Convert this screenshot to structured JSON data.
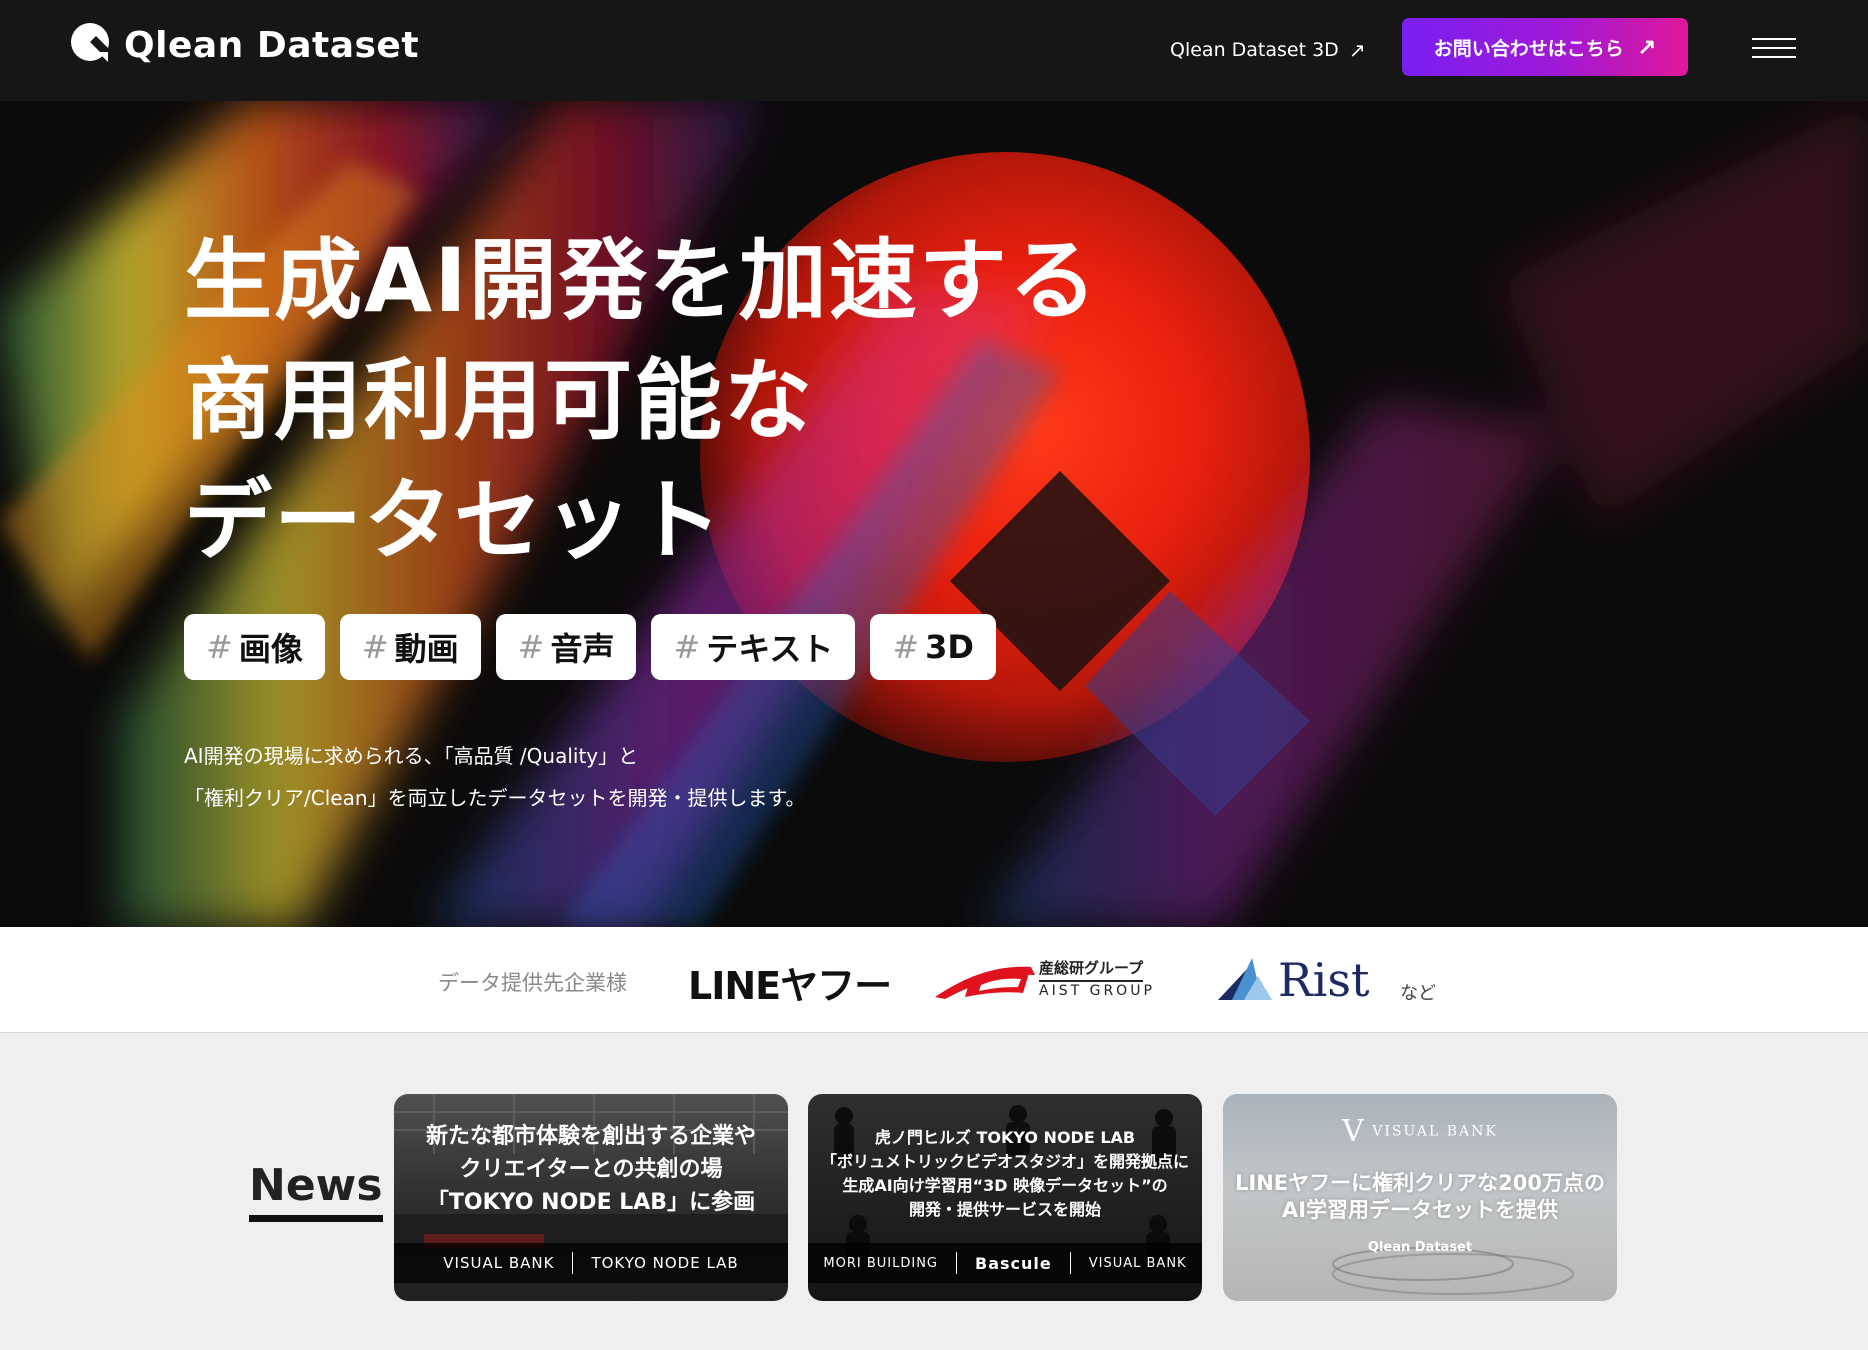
{
  "header": {
    "logo_text": "Qlean Dataset",
    "nav_link_label": "Qlean Dataset 3D",
    "cta_label": "お問い合わせはこちら"
  },
  "hero": {
    "headline": [
      "生成AI開発を加速する",
      "商用利用可能な",
      "データセット"
    ],
    "tags": [
      {
        "hash": "#",
        "label": "画像"
      },
      {
        "hash": "#",
        "label": "動画"
      },
      {
        "hash": "#",
        "label": "音声"
      },
      {
        "hash": "#",
        "label": "テキスト"
      },
      {
        "hash": "#",
        "label": "3D"
      }
    ],
    "description": [
      "AI開発の現場に求められる、「高品質 /Quality」と",
      "「権利クリア/Clean」を両立したデータセットを開発・提供します。"
    ]
  },
  "partners": {
    "label": "データ提供先企業様",
    "logos": {
      "line": "LINEヤフー",
      "aist_jp": "産総研グループ",
      "aist_en": "AIST GROUP",
      "rist": "Rist"
    },
    "suffix": "など"
  },
  "news": {
    "title": "News",
    "cards": [
      {
        "title": [
          "新たな都市体験を創出する企業や",
          "クリエイターとの共創の場",
          "「TOKYO NODE LAB」に参画"
        ],
        "footer": [
          "VISUAL BANK",
          "TOKYO NODE LAB"
        ]
      },
      {
        "title": [
          "虎ノ門ヒルズ TOKYO NODE LAB",
          "「ボリュメトリックビデオスタジオ」を開発拠点に",
          "生成AI向け学習用“3D 映像データセット”の",
          "開発・提供サービスを開始"
        ],
        "footer": [
          "MORI BUILDING",
          "Bascule",
          "VISUAL BANK"
        ]
      },
      {
        "brand": "VISUAL BANK",
        "title": [
          "LINEヤフーに権利クリアな200万点の",
          "AI学習用データセットを提供"
        ],
        "sub": "Qlean Dataset"
      }
    ]
  },
  "colors": {
    "header_bg": "#161616",
    "cta_gradient_start": "#7a1ff2",
    "cta_gradient_end": "#e0189a",
    "news_bg": "#efefef"
  },
  "icons": {
    "logo": "q-magnifier-icon",
    "external_link": "arrow-up-right-icon",
    "menu": "hamburger-menu-icon"
  }
}
